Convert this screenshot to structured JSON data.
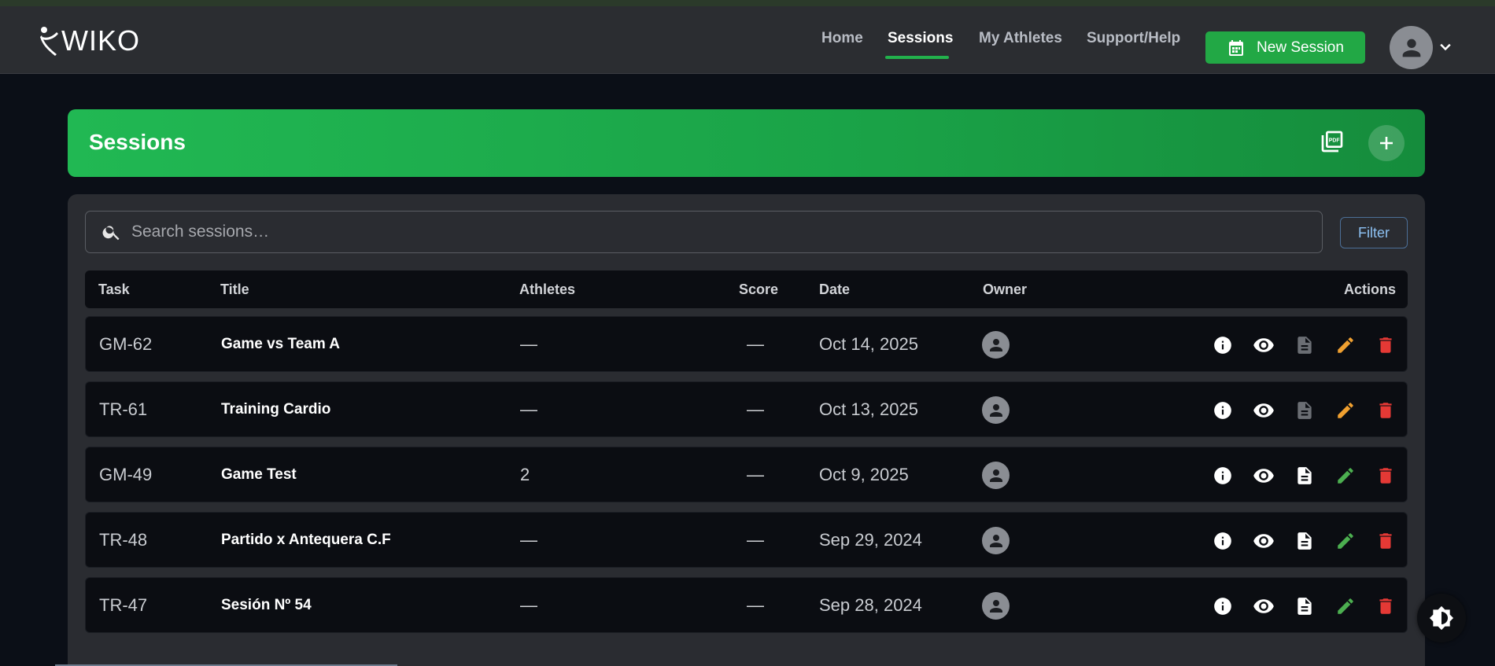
{
  "brand": {
    "logo_text": "WIKO"
  },
  "nav": {
    "links": [
      {
        "label": "Home",
        "active": false
      },
      {
        "label": "Sessions",
        "active": true
      },
      {
        "label": "My Athletes",
        "active": false
      },
      {
        "label": "Support/Help",
        "active": false
      }
    ],
    "new_session_label": "New Session"
  },
  "page": {
    "title": "Sessions",
    "pdf_label": "PDF"
  },
  "search": {
    "placeholder": "Search sessions…"
  },
  "filter_label": "Filter",
  "table": {
    "headers": [
      "Task",
      "Title",
      "Athletes",
      "Score",
      "Date",
      "Owner",
      "Actions"
    ],
    "rows": [
      {
        "task": "GM-62",
        "title": "Game vs Team A",
        "athletes": "—",
        "score": "—",
        "date": "Oct 14, 2025",
        "notes_enabled": false,
        "edit_color": "#f0a030"
      },
      {
        "task": "TR-61",
        "title": "Training Cardio",
        "athletes": "—",
        "score": "—",
        "date": "Oct 13, 2025",
        "notes_enabled": false,
        "edit_color": "#f0a030"
      },
      {
        "task": "GM-49",
        "title": "Game Test",
        "athletes": "2",
        "score": "—",
        "date": "Oct 9, 2025",
        "notes_enabled": true,
        "edit_color": "#4caf50"
      },
      {
        "task": "TR-48",
        "title": "Partido x Antequera C.F",
        "athletes": "—",
        "score": "—",
        "date": "Sep 29, 2024",
        "notes_enabled": true,
        "edit_color": "#4caf50"
      },
      {
        "task": "TR-47",
        "title": "Sesión Nº 54",
        "athletes": "—",
        "score": "—",
        "date": "Sep 28, 2024",
        "notes_enabled": true,
        "edit_color": "#4caf50"
      }
    ]
  },
  "colors": {
    "accent": "#22b14c",
    "danger": "#e53935",
    "info_blue": "#8cc0f2"
  }
}
